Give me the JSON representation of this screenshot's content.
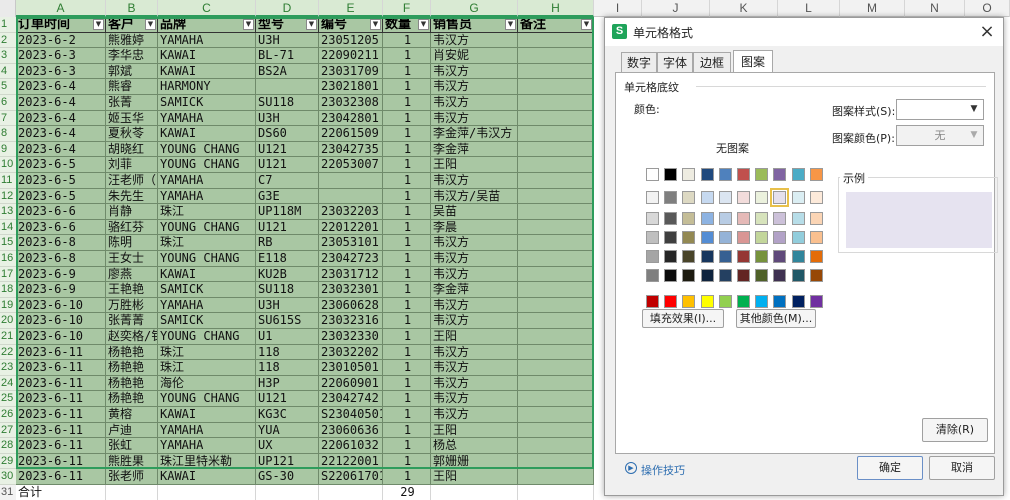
{
  "sheet": {
    "columns": [
      "A",
      "B",
      "C",
      "D",
      "E",
      "F",
      "G",
      "H",
      "I",
      "J",
      "K",
      "L",
      "M",
      "N",
      "O"
    ],
    "row_numbers": [
      "1",
      "2",
      "3",
      "4",
      "5",
      "6",
      "7",
      "8",
      "9",
      "10",
      "11",
      "12",
      "13",
      "14",
      "15",
      "16",
      "17",
      "18",
      "19",
      "20",
      "21",
      "22",
      "23",
      "24",
      "25",
      "26",
      "27",
      "28",
      "29",
      "30",
      "31"
    ],
    "headers": [
      "订单时间",
      "客户",
      "品牌",
      "型号",
      "编号",
      "数量",
      "销售员",
      "备注"
    ],
    "rows": [
      [
        "2023-6-2",
        "熊雅婷",
        "YAMAHA",
        "U3H",
        "23051205",
        "1",
        "韦汉方",
        ""
      ],
      [
        "2023-6-3",
        "李华忠",
        "KAWAI",
        "BL-71",
        "22090211",
        "1",
        "肖安妮",
        ""
      ],
      [
        "2023-6-3",
        "郭斌",
        "KAWAI",
        "BS2A",
        "23031709",
        "1",
        "韦汉方",
        ""
      ],
      [
        "2023-6-4",
        "熊睿",
        "HARMONY",
        "",
        "23021801",
        "1",
        "韦汉方",
        ""
      ],
      [
        "2023-6-4",
        "张菁",
        "SAMICK",
        "SU118",
        "23032308",
        "1",
        "韦汉方",
        ""
      ],
      [
        "2023-6-4",
        "姬玉华",
        "YAMAHA",
        "U3H",
        "23042801",
        "1",
        "韦汉方",
        ""
      ],
      [
        "2023-6-4",
        "夏秋苓",
        "KAWAI",
        "DS60",
        "22061509",
        "1",
        "李金萍/韦汉方",
        ""
      ],
      [
        "2023-6-4",
        "胡晓红",
        "YOUNG CHANG",
        "U121",
        "23042735",
        "1",
        "李金萍",
        ""
      ],
      [
        "2023-6-5",
        "刘菲",
        "YOUNG CHANG",
        "U121",
        "22053007",
        "1",
        "王阳",
        ""
      ],
      [
        "2023-6-5",
        "汪老师（",
        "YAMAHA",
        "C7",
        "",
        "1",
        "韦汉方",
        ""
      ],
      [
        "2023-6-5",
        "朱先生",
        "YAMAHA",
        "G3E",
        "",
        "1",
        "韦汉方/吴苗",
        ""
      ],
      [
        "2023-6-6",
        "肖静",
        "珠江",
        "UP118M",
        "23032203",
        "1",
        "吴苗",
        ""
      ],
      [
        "2023-6-6",
        "骆红芬",
        "YOUNG CHANG",
        "U121",
        "22012201",
        "1",
        "李晨",
        ""
      ],
      [
        "2023-6-8",
        "陈明",
        "珠江",
        "RB",
        "23053101",
        "1",
        "韦汉方",
        ""
      ],
      [
        "2023-6-8",
        "王女士",
        "YOUNG CHANG",
        "E118",
        "23042723",
        "1",
        "韦汉方",
        ""
      ],
      [
        "2023-6-9",
        "廖燕",
        "KAWAI",
        "KU2B",
        "23031712",
        "1",
        "韦汉方",
        ""
      ],
      [
        "2023-6-9",
        "王艳艳",
        "SAMICK",
        "SU118",
        "23032301",
        "1",
        "李金萍",
        ""
      ],
      [
        "2023-6-10",
        "万胜彬",
        "YAMAHA",
        "U3H",
        "23060628",
        "1",
        "韦汉方",
        ""
      ],
      [
        "2023-6-10",
        "张菁菁",
        "SAMICK",
        "SU615S",
        "23032316",
        "1",
        "韦汉方",
        ""
      ],
      [
        "2023-6-10",
        "赵奕格/钅",
        "YOUNG CHANG",
        "U1",
        "23032330",
        "1",
        "王阳",
        ""
      ],
      [
        "2023-6-11",
        "杨艳艳",
        "珠江",
        "118",
        "23032202",
        "1",
        "韦汉方",
        ""
      ],
      [
        "2023-6-11",
        "杨艳艳",
        "珠江",
        "118",
        "23010501",
        "1",
        "韦汉方",
        ""
      ],
      [
        "2023-6-11",
        "杨艳艳",
        "海伦",
        "H3P",
        "22060901",
        "1",
        "韦汉方",
        ""
      ],
      [
        "2023-6-11",
        "杨艳艳",
        "YOUNG CHANG",
        "U121",
        "23042742",
        "1",
        "韦汉方",
        ""
      ],
      [
        "2023-6-11",
        "黄榕",
        "KAWAI",
        "KG3C",
        "S23040501",
        "1",
        "韦汉方",
        ""
      ],
      [
        "2023-6-11",
        "卢迪",
        "YAMAHA",
        "YUA",
        "23060636",
        "1",
        "王阳",
        ""
      ],
      [
        "2023-6-11",
        "张虹",
        "YAMAHA",
        "UX",
        "22061032",
        "1",
        "杨总",
        ""
      ],
      [
        "2023-6-11",
        "熊胜果",
        "珠江里特米勒",
        "UP121",
        "22122001",
        "1",
        "郭姗姗",
        ""
      ],
      [
        "2023-6-11",
        "张老师",
        "KAWAI",
        "GS-30",
        "S22061701",
        "1",
        "王阳",
        ""
      ]
    ],
    "total_row": [
      "合计",
      "",
      "",
      "",
      "",
      "29",
      "",
      ""
    ]
  },
  "dialog": {
    "title": "单元格格式",
    "app_icon_letter": "S",
    "close_symbol": "×",
    "tabs": [
      "数字",
      "字体",
      "边框",
      "图案"
    ],
    "active_tab": "图案",
    "group_title": "单元格底纹",
    "color_label": "颜色:",
    "no_pattern": "无图案",
    "fill_effects_button": "填充效果(I)...",
    "more_colors_button": "其他颜色(M)...",
    "pattern_style_label": "图案样式(S):",
    "pattern_style_value": "",
    "pattern_color_label": "图案颜色(P):",
    "pattern_color_value": "无",
    "sample_label": "示例",
    "clear_button": "清除(R)",
    "tips_link": "操作技巧",
    "ok_button": "确定",
    "cancel_button": "取消",
    "selected_color": "#e6e3f0",
    "palette_rows": [
      [
        "#ffffff",
        "#000000",
        "#eeece1",
        "#1f497d",
        "#4f81bd",
        "#c0504d",
        "#9bbb59",
        "#8064a2",
        "#4bacc6",
        "#f79646"
      ],
      [
        "#f2f2f2",
        "#7f7f7f",
        "#ddd9c3",
        "#c6d9f0",
        "#dbe5f1",
        "#f2dcdb",
        "#ebf1dd",
        "#e5e0ec",
        "#dbeef3",
        "#fdeada"
      ],
      [
        "#d8d8d8",
        "#595959",
        "#c4bd97",
        "#8db3e2",
        "#b8cce4",
        "#e5b9b7",
        "#d7e3bc",
        "#ccc1d9",
        "#b7dde8",
        "#fbd5b5"
      ],
      [
        "#bfbfbf",
        "#3f3f3f",
        "#938953",
        "#548dd4",
        "#95b3d7",
        "#d99694",
        "#c3d69b",
        "#b2a2c7",
        "#92cddc",
        "#fac08f"
      ],
      [
        "#a5a5a5",
        "#262626",
        "#494429",
        "#17365d",
        "#366092",
        "#953734",
        "#76923c",
        "#5f497a",
        "#31859b",
        "#e36c09"
      ],
      [
        "#7f7f7f",
        "#0c0c0c",
        "#1d1b10",
        "#0f243e",
        "#244061",
        "#632423",
        "#4f6128",
        "#3f3151",
        "#205867",
        "#974806"
      ],
      [
        "#c00000",
        "#ff0000",
        "#ffc000",
        "#ffff00",
        "#92d050",
        "#00b050",
        "#00b0f0",
        "#0070c0",
        "#002060",
        "#7030a0"
      ]
    ],
    "selected_swatch": "row1-col7"
  },
  "colors": {
    "cell_fill": "#a9c7a3",
    "selection_border": "#2e9c5c",
    "accent": "#1fa45a"
  }
}
